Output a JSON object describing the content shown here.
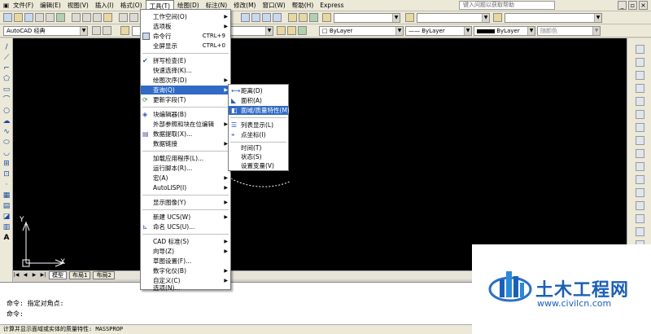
{
  "menubar": {
    "items": [
      "文件(F)",
      "编辑(E)",
      "视图(V)",
      "插入(I)",
      "格式(O)",
      "工具(T)",
      "绘图(D)",
      "标注(N)",
      "修改(M)",
      "窗口(W)",
      "帮助(H)",
      "Express"
    ],
    "active": "工具(T)"
  },
  "help_search": {
    "placeholder": "键入问题以获取帮助"
  },
  "toolbar2": {
    "workspace": "AutoCAD 经典",
    "linetype_1": "ByLayer",
    "linetype_2": "ByLayer",
    "lineweight": "ByLayer",
    "plotstyle": "随颜色"
  },
  "tools_menu": {
    "items": [
      {
        "label": "工作空间(O)",
        "shortcut": "",
        "submenu": true
      },
      {
        "label": "选项板",
        "shortcut": "",
        "submenu": true
      },
      {
        "label": "命令行",
        "shortcut": "CTRL+9",
        "submenu": false
      },
      {
        "label": "全屏显示",
        "shortcut": "CTRL+0",
        "submenu": false
      },
      {
        "label": "拼写检查(E)",
        "shortcut": "",
        "submenu": false
      },
      {
        "label": "快速选择(K)...",
        "shortcut": "",
        "submenu": false
      },
      {
        "label": "绘图次序(D)",
        "shortcut": "",
        "submenu": true
      },
      {
        "label": "查询(Q)",
        "shortcut": "",
        "submenu": true
      },
      {
        "label": "更新字段(T)",
        "shortcut": "",
        "submenu": false
      },
      {
        "label": "块编辑器(B)",
        "shortcut": "",
        "submenu": false
      },
      {
        "label": "外部参照和块在位编辑",
        "shortcut": "",
        "submenu": true
      },
      {
        "label": "数据提取(X)...",
        "shortcut": "",
        "submenu": false
      },
      {
        "label": "数据链接",
        "shortcut": "",
        "submenu": true
      },
      {
        "label": "加载应用程序(L)...",
        "shortcut": "",
        "submenu": false
      },
      {
        "label": "运行脚本(R)...",
        "shortcut": "",
        "submenu": false
      },
      {
        "label": "宏(A)",
        "shortcut": "",
        "submenu": true
      },
      {
        "label": "AutoLISP(I)",
        "shortcut": "",
        "submenu": true
      },
      {
        "label": "显示图像(Y)",
        "shortcut": "",
        "submenu": true
      },
      {
        "label": "新建 UCS(W)",
        "shortcut": "",
        "submenu": true
      },
      {
        "label": "命名 UCS(U)...",
        "shortcut": "",
        "submenu": false
      },
      {
        "label": "CAD 标准(S)",
        "shortcut": "",
        "submenu": true
      },
      {
        "label": "向导(Z)",
        "shortcut": "",
        "submenu": true
      },
      {
        "label": "草图设置(F)...",
        "shortcut": "",
        "submenu": false
      },
      {
        "label": "数字化仪(B)",
        "shortcut": "",
        "submenu": true
      },
      {
        "label": "自定义(C)",
        "shortcut": "",
        "submenu": true
      },
      {
        "label": "选项(N)...",
        "shortcut": "",
        "submenu": false
      }
    ],
    "highlighted": "查询(Q)"
  },
  "query_submenu": {
    "items": [
      "距离(D)",
      "面积(A)",
      "面域/质量特性(M)",
      "列表显示(L)",
      "点坐标(I)",
      "时间(T)",
      "状态(S)",
      "设置变量(V)"
    ],
    "highlighted": "面域/质量特性(M)"
  },
  "ucs": {
    "x": "X",
    "y": "Y"
  },
  "layout_tabs": {
    "model": "模型",
    "layout1": "布局1",
    "layout2": "布局2"
  },
  "command": {
    "line1": "命令: 指定对角点:",
    "line2": "命令:"
  },
  "status": "计算并显示面域或实体的质量特性:  MASSPROP",
  "watermark": {
    "title": "土木工程网",
    "url": "www.civilcn.com"
  },
  "colors": {
    "canvas": "#000000",
    "menu_highlight": "#316ac5",
    "brand": "#1a60b8"
  }
}
